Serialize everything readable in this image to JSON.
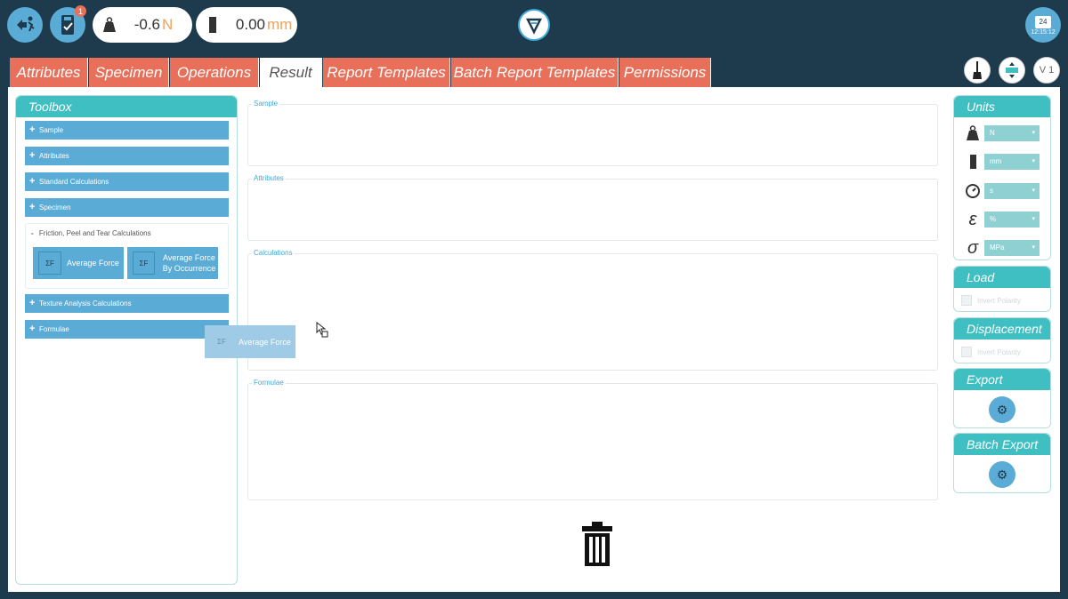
{
  "topbar": {
    "notification_count": "1",
    "load": {
      "value": "-0.6",
      "unit": "N"
    },
    "displacement": {
      "value": "0.00",
      "unit": "mm"
    },
    "clock": {
      "day": "24",
      "time": "12:15:12"
    }
  },
  "tabs": [
    {
      "label": "Attributes",
      "active": false
    },
    {
      "label": "Specimen",
      "active": false
    },
    {
      "label": "Operations",
      "active": false
    },
    {
      "label": "Result",
      "active": true
    },
    {
      "label": "Report Templates",
      "active": false
    },
    {
      "label": "Batch Report Templates",
      "active": false
    },
    {
      "label": "Permissions",
      "active": false
    }
  ],
  "right_tools": {
    "version": "V 1"
  },
  "toolbox": {
    "title": "Toolbox",
    "items": [
      "Sample",
      "Attributes",
      "Standard Calculations",
      "Specimen"
    ],
    "open_group": {
      "title": "Friction, Peel and Tear Calculations",
      "buttons": [
        "Average Force",
        "Average Force By Occurrence"
      ]
    },
    "items_after": [
      "Texture Analysis Calculations",
      "Formulae"
    ]
  },
  "drag_ghost": {
    "label": "Average Force"
  },
  "sections": [
    "Sample",
    "Attributes",
    "Calculations",
    "Formulae"
  ],
  "units": {
    "title": "Units",
    "rows": [
      {
        "icon": "weight-icon",
        "value": "N"
      },
      {
        "icon": "length-icon",
        "value": "mm"
      },
      {
        "icon": "clock-icon",
        "value": "s"
      },
      {
        "icon": "epsilon-icon",
        "value": "%"
      },
      {
        "icon": "sigma-icon",
        "value": "MPa"
      }
    ]
  },
  "load_panel": {
    "title": "Load",
    "invert": "Invert Polarity"
  },
  "displacement_panel": {
    "title": "Displacement",
    "invert": "Invert Polarity"
  },
  "export_panel": {
    "title": "Export"
  },
  "batch_export_panel": {
    "title": "Batch Export"
  },
  "colors": {
    "accent": "#3fbfc2",
    "tab": "#e8705a",
    "blue": "#5aabd6",
    "navy": "#1e3a4d"
  }
}
